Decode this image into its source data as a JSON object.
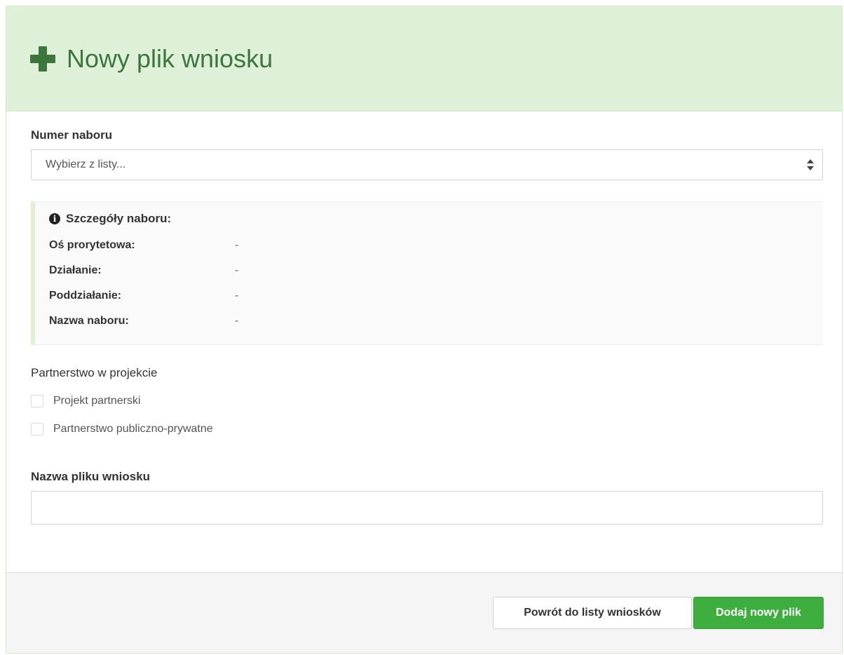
{
  "header": {
    "title": "Nowy plik wniosku",
    "icon": "plus-icon"
  },
  "numer_naboru": {
    "label": "Numer naboru",
    "selected": "Wybierz z listy..."
  },
  "details": {
    "heading": "Szczegóły naboru:",
    "rows": [
      {
        "key": "Oś prorytetowa:",
        "value": "-"
      },
      {
        "key": "Działanie:",
        "value": "-"
      },
      {
        "key": "Poddziałanie:",
        "value": "-"
      },
      {
        "key": "Nazwa naboru:",
        "value": "-"
      }
    ]
  },
  "partnerstwo": {
    "label": "Partnerstwo w projekcie",
    "options": [
      {
        "label": "Projekt partnerski",
        "checked": false
      },
      {
        "label": "Partnerstwo publiczno-prywatne",
        "checked": false
      }
    ]
  },
  "nazwa_pliku": {
    "label": "Nazwa pliku wniosku",
    "value": ""
  },
  "footer": {
    "back_label": "Powrót do listy wniosków",
    "add_label": "Dodaj nowy plik"
  },
  "colors": {
    "header_bg": "#dff0d8",
    "accent_green": "#3c763d",
    "success": "#3eae3e"
  }
}
